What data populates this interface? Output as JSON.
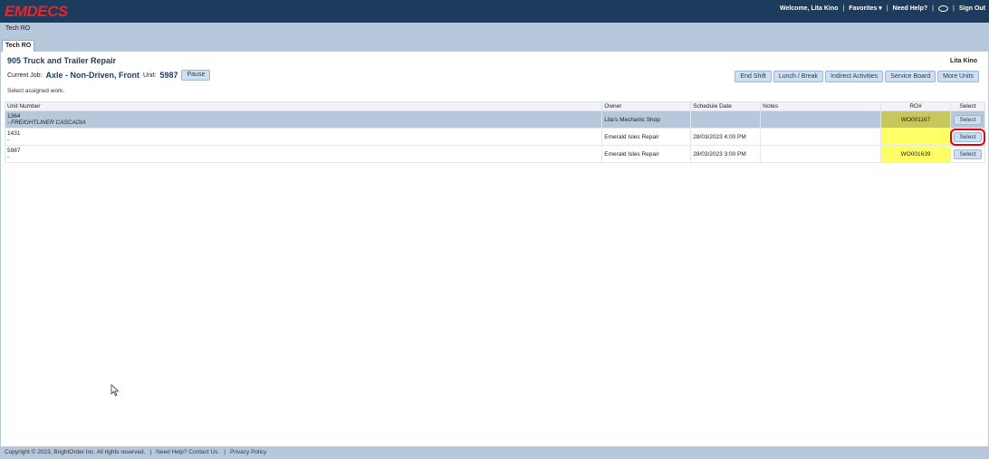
{
  "app": {
    "logo": "EMDECS",
    "welcome": "Welcome, Lita Kino",
    "favorites": "Favorites ▾",
    "need_help": "Need Help?",
    "sign_out": "Sign Out"
  },
  "breadcrumb": "Tech RO",
  "tabs": [
    {
      "label": "Tech RO"
    }
  ],
  "header": {
    "shop": "905 Truck and Trailer Repair",
    "user": "Lita Kino",
    "current_job_label": "Current Job:",
    "current_job": "Axle - Non-Driven, Front",
    "unit_label": "Unit:",
    "unit": "5987",
    "pause": "Pause",
    "hint": "Select assigned work."
  },
  "actions": [
    "End Shift",
    "Lunch / Break",
    "Indirect Activities",
    "Service Board",
    "More Units"
  ],
  "table": {
    "headers": [
      "Unit Number",
      "Owner",
      "Schedule Date",
      "Notes",
      "RO#",
      "Select"
    ],
    "rows": [
      {
        "unit": "1364",
        "sub": "- FREIGHTLINER CASCADIA",
        "owner": "Lita's Mechanic Shop",
        "date": "",
        "notes": "",
        "ro": "WO001167",
        "select": "Select"
      },
      {
        "unit": "1431",
        "sub": "-",
        "owner": "Emerald Isles Repair",
        "date": "28/03/2023 4:00 PM",
        "notes": "",
        "ro": "",
        "select": "Select"
      },
      {
        "unit": "5987",
        "sub": "-",
        "owner": "Emerald Isles Repair",
        "date": "28/03/2023 3:00 PM",
        "notes": "",
        "ro": "WO001639",
        "select": "Select"
      }
    ]
  },
  "footer": {
    "copyright": "Copyright © 2023, BrightOrder Inc. All rights reserved.",
    "help": "Need Help? Contact Us.",
    "privacy": "Privacy Policy"
  },
  "colors": {
    "topbar": "#1d3b5c",
    "logo": "#e8262c",
    "highlight_ro": "#ffff66",
    "selected_row": "#b7c8dc",
    "focus_outline": "#e00010"
  }
}
